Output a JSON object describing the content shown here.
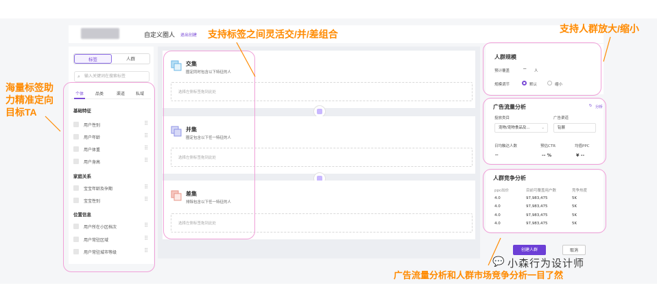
{
  "header": {
    "app_title": "自定义圈人",
    "exit_link": "退出创建"
  },
  "left_panel": {
    "segments": [
      "标签",
      "人群"
    ],
    "search_placeholder": "输入关键词在搜索标签",
    "tabs": [
      "个体",
      "品类",
      "渠道",
      "私域"
    ],
    "groups": [
      {
        "title": "基础特征",
        "items": [
          "用户性别",
          "用户年龄",
          "用户体重",
          "用户身高"
        ]
      },
      {
        "title": "家庭关系",
        "items": [
          "宝宝年龄及孕期",
          "宝宝性别"
        ]
      },
      {
        "title": "位置信息",
        "items": [
          "用户所在小区档次",
          "用户常驻区域",
          "用户常驻城市等级"
        ]
      }
    ]
  },
  "cards": [
    {
      "title": "交集",
      "desc": "圈定同时包含以下特征的人",
      "drop": "选择左侧标签拖到此处"
    },
    {
      "title": "并集",
      "desc": "圈定包含以下任一特征的人",
      "drop": "选择左侧标签拖到此处"
    },
    {
      "title": "差集",
      "desc": "排除包含以下任一特征的人",
      "drop": "选择左侧标签拖到此处"
    }
  ],
  "audience_scale": {
    "title": "人群规模",
    "label_size": "预计覆盖",
    "size_value": "--",
    "size_unit": "人",
    "label_mode": "规模调节",
    "option_default": "默认",
    "option_shrink": "缩小"
  },
  "ad_traffic": {
    "title": "广告流量分析",
    "analyze_link": "分析",
    "label_category": "投放类目",
    "category_value": "宠物/宠物食品及...",
    "label_scene": "广告渠道",
    "scene_value": "钻展",
    "metrics": [
      {
        "label": "日均触达人数",
        "value": "--"
      },
      {
        "label": "预估CTR",
        "value": "-- %"
      },
      {
        "label": "均值PPC",
        "value": "¥ --"
      }
    ]
  },
  "competition": {
    "title": "人群竞争分析",
    "headers": [
      "ppc出价",
      "目前可覆盖用户数",
      "竞争热度"
    ],
    "rows": [
      [
        "4.0",
        "97,983,475",
        "5K"
      ],
      [
        "4.0",
        "97,983,475",
        "5K"
      ],
      [
        "4.0",
        "97,983,475",
        "5K"
      ],
      [
        "4.0",
        "97,983,475",
        "5K"
      ]
    ]
  },
  "actions": {
    "create": "创建人群",
    "cancel": "取消"
  },
  "annotations": {
    "top": "支持标签之间灵活交/并/差组合",
    "top_right": "支持人群放大/缩小",
    "left": [
      "海量标签助",
      "力精准定向",
      "目标TA"
    ],
    "bottom": "广告流量分析和人群市场竞争分析一目了然"
  },
  "watermark": "小森行为设计师",
  "colors": {
    "accent": "#7a4bd6",
    "annotation": "#ff8a00",
    "highlight": "#f0a0d8"
  }
}
